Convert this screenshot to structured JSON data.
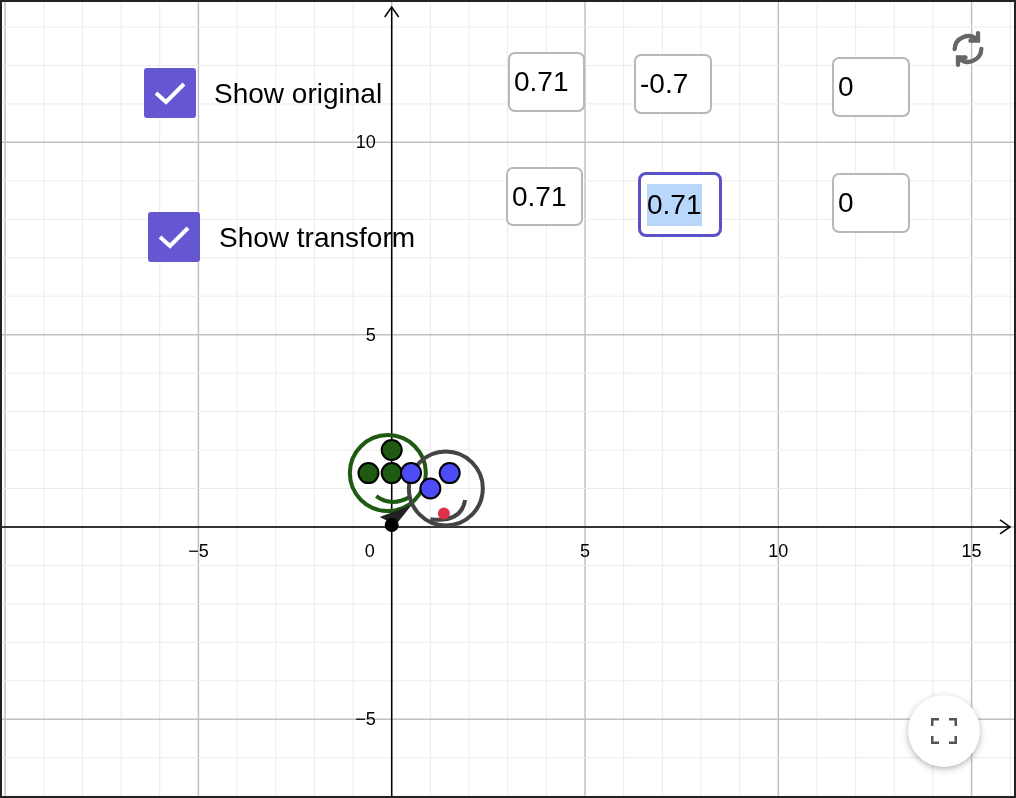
{
  "checkboxes": [
    {
      "label": "Show original",
      "checked": true
    },
    {
      "label": "Show transform",
      "checked": true
    }
  ],
  "matrix_inputs": [
    {
      "value": "0.71",
      "focused": false
    },
    {
      "value": "-0.7",
      "focused": false
    },
    {
      "value": "0",
      "focused": false
    },
    {
      "value": "0.71",
      "focused": false
    },
    {
      "value": "0.71",
      "focused": true
    },
    {
      "value": "0",
      "focused": false
    }
  ],
  "graph": {
    "x_tick_labels": [
      "−5",
      "0",
      "5",
      "10",
      "15"
    ],
    "y_tick_labels": [
      "10",
      "5",
      "−5"
    ]
  }
}
